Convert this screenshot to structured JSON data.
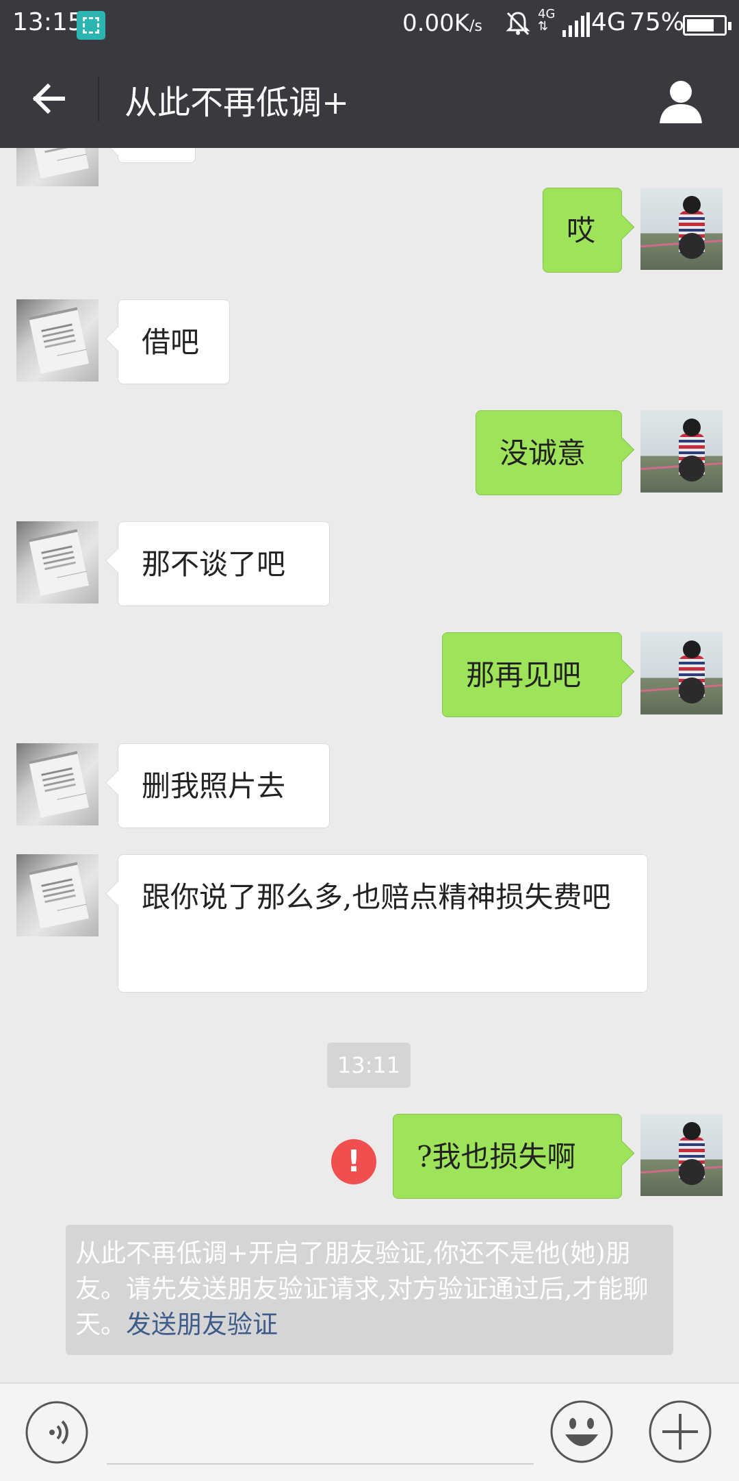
{
  "status_bar": {
    "time": "13:15",
    "speed_value": "0.00K",
    "speed_unit": "/s",
    "net_label": "4G",
    "network": "4G",
    "battery_pct": "75%",
    "battery_level": 0.75
  },
  "header": {
    "title": "从此不再低调+"
  },
  "messages": [
    {
      "side": "other",
      "text": ""
    },
    {
      "side": "me",
      "text": "哎"
    },
    {
      "side": "other",
      "text": "借吧"
    },
    {
      "side": "me",
      "text": "没诚意"
    },
    {
      "side": "other",
      "text": "那不谈了吧"
    },
    {
      "side": "me",
      "text": "那再见吧"
    },
    {
      "side": "other",
      "text": "删我照片去"
    },
    {
      "side": "other",
      "text": "跟你说了那么多,也赔点精神损失费吧"
    },
    {
      "side": "me",
      "text": "?我也损失啊",
      "status": "failed"
    }
  ],
  "timestamp": "13:11",
  "notice": {
    "text": "从此不再低调+开启了朋友验证,你还不是他(她)朋友。请先发送朋友验证请求,对方验证通过后,才能聊天。",
    "link": "发送朋友验证"
  },
  "colors": {
    "header_bg": "#393a3f",
    "chat_bg": "#ebebeb",
    "my_bubble": "#9ee45a",
    "other_bubble": "#ffffff",
    "error": "#ef4f4f",
    "link": "#3d5c8a"
  },
  "icons": {
    "back": "back-arrow-icon",
    "profile": "person-icon",
    "voice": "voice-icon",
    "emoji": "smiley-icon",
    "more": "plus-icon",
    "error": "exclamation-icon"
  }
}
